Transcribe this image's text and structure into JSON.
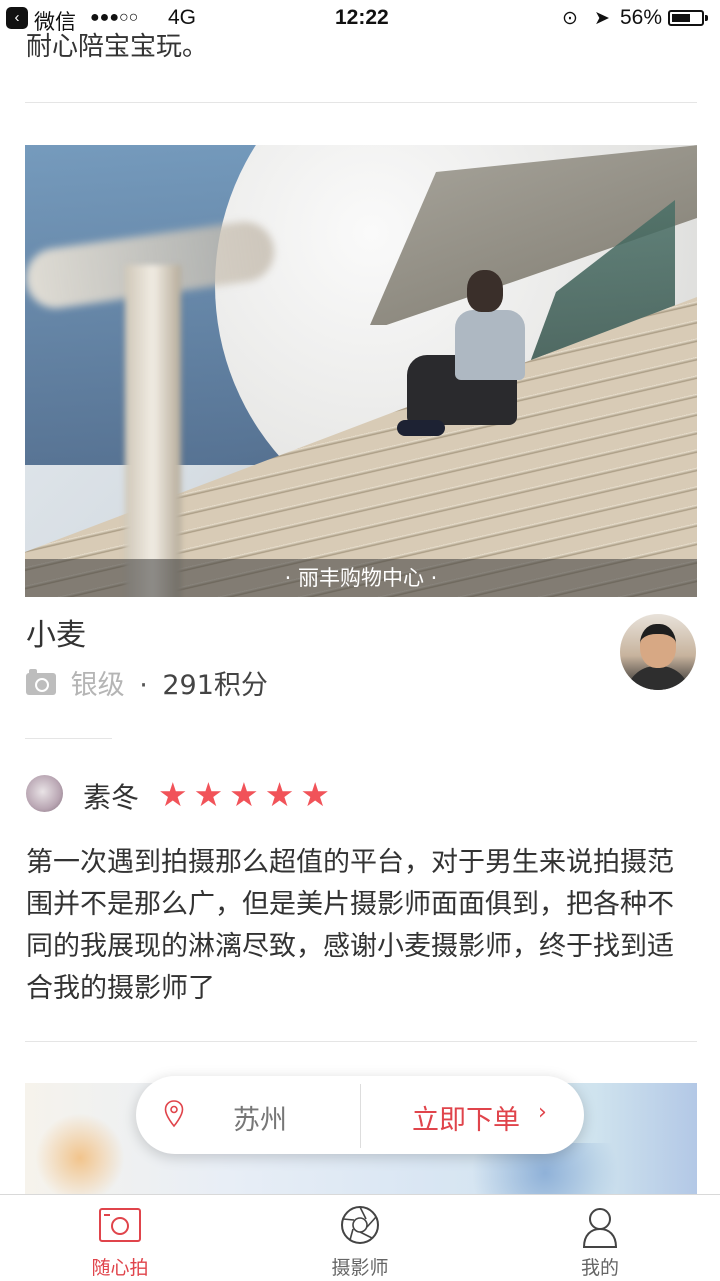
{
  "status_bar": {
    "back_app": "微信",
    "signal": "●●●○○",
    "network": "4G",
    "time": "12:22",
    "battery": "56%",
    "battery_level": 0.56
  },
  "previous_review_tail": "耐心陪宝宝玩。",
  "photo_card": {
    "location": "· 丽丰购物中心 ·"
  },
  "photographer": {
    "name": "小麦",
    "level": "银级",
    "separator": "·",
    "points": "291积分"
  },
  "review": {
    "reviewer": "素冬",
    "stars": "★★★★★",
    "rating": 5,
    "text": "第一次遇到拍摄那么超值的平台，对于男生来说拍摄范围并不是那么广，但是美片摄影师面面俱到，把各种不同的我展现的淋漓尽致，感谢小麦摄影师，终于找到适合我的摄影师了"
  },
  "order_bar": {
    "city": "苏州",
    "order_label": "立即下单",
    "chevron": "›"
  },
  "tabbar": {
    "tabs": [
      {
        "label": "随心拍",
        "icon": "camera-frame-icon",
        "active": true
      },
      {
        "label": "摄影师",
        "icon": "aperture-icon",
        "active": false
      },
      {
        "label": "我的",
        "icon": "person-icon",
        "active": false
      }
    ]
  },
  "colors": {
    "accent": "#e0444b",
    "star": "#f15359",
    "muted_text": "#b5b5b5",
    "divider": "#e5e5e5"
  }
}
